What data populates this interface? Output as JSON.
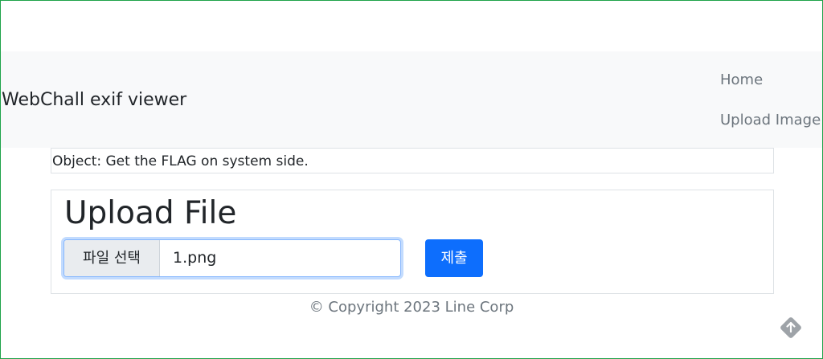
{
  "navbar": {
    "brand": "WebChall exif viewer",
    "links": [
      {
        "label": "Home"
      },
      {
        "label": "Upload Image"
      }
    ]
  },
  "objective": {
    "text": "Object: Get the FLAG on system side."
  },
  "upload": {
    "title": "Upload File",
    "file_button_label": "파일 선택",
    "file_name": "1.png",
    "submit_label": "제출"
  },
  "footer": {
    "text": "© Copyright 2023 Line Corp"
  },
  "colors": {
    "navbar_bg": "#f8f9fa",
    "primary": "#0d6efd",
    "muted_text": "#6c757d",
    "border": "#dee2e6",
    "frame": "#1fa34a"
  },
  "icons": {
    "corner": "translate-extension-icon"
  }
}
